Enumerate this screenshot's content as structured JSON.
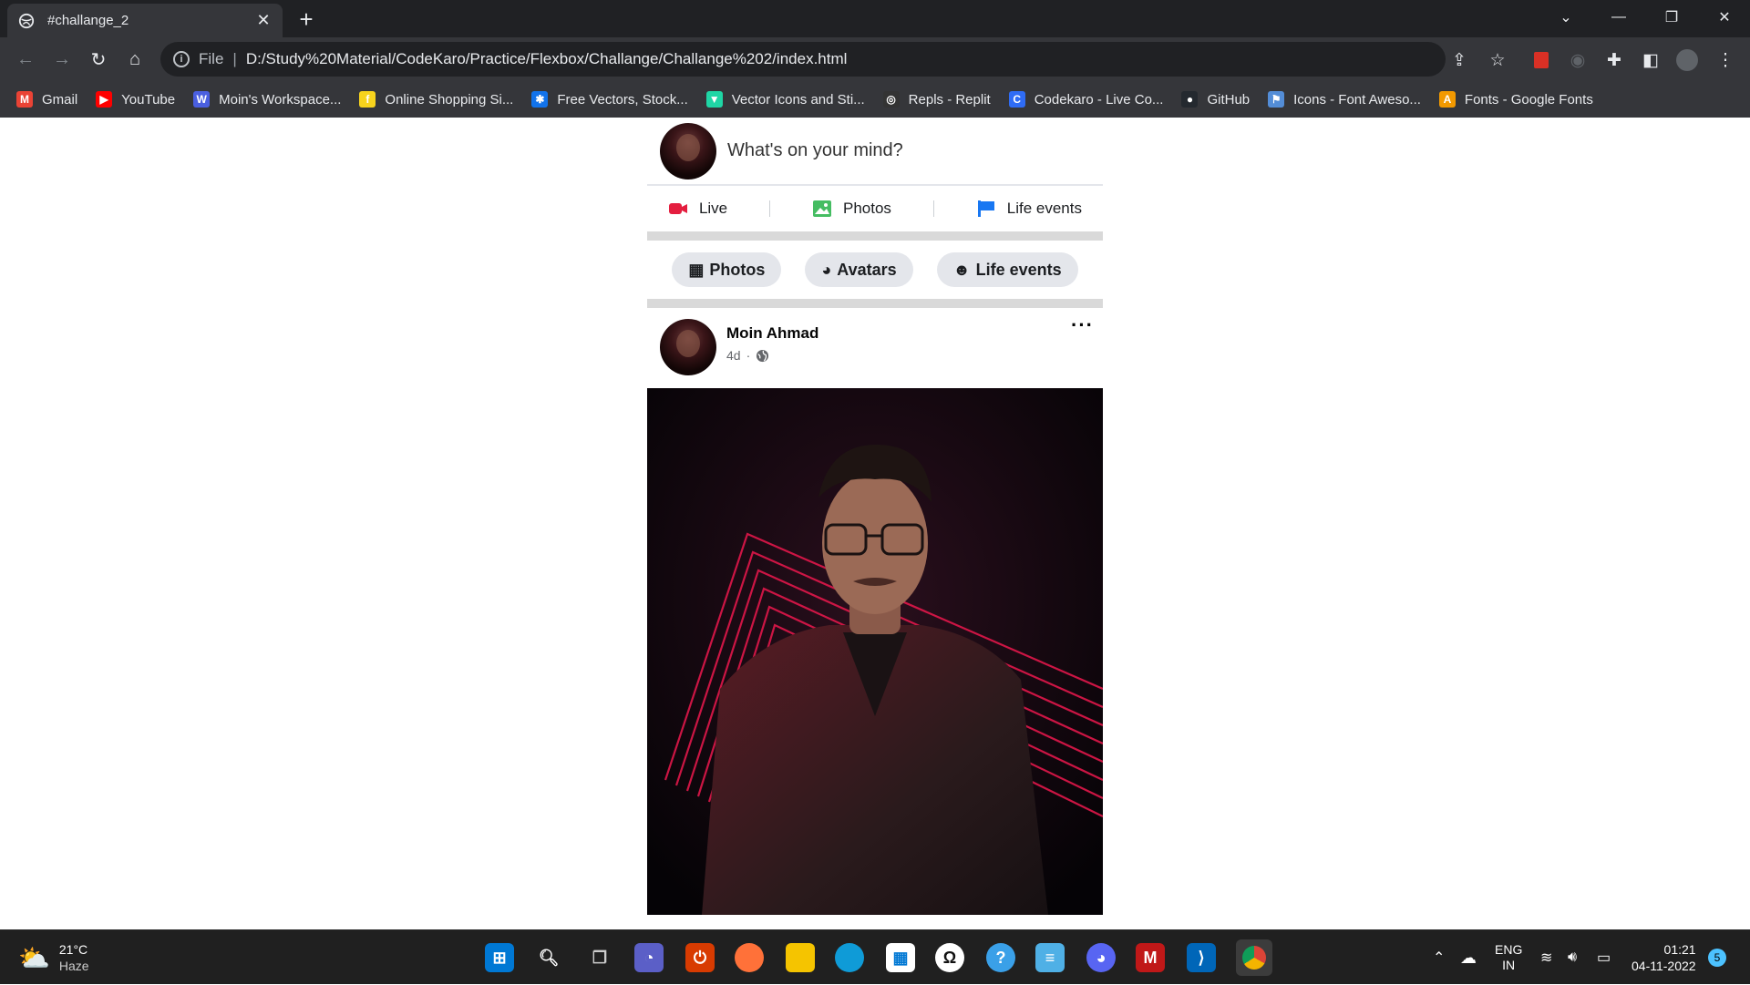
{
  "browser": {
    "tab_title": "#challange_2",
    "new_tab": "+",
    "address": {
      "scheme_label": "File",
      "separator": "|",
      "url": "D:/Study%20Material/CodeKaro/Practice/Flexbox/Challange/Challange%202/index.html"
    },
    "bookmarks": [
      {
        "label": "Gmail",
        "icon": "gmail-icon",
        "color": "#ea4335",
        "glyph": "M"
      },
      {
        "label": "YouTube",
        "icon": "youtube-icon",
        "color": "#ff0000",
        "glyph": "▶"
      },
      {
        "label": "Moin's Workspace...",
        "icon": "workspace-icon",
        "color": "#4a5fe0",
        "glyph": "W"
      },
      {
        "label": "Online Shopping Si...",
        "icon": "flipkart-icon",
        "color": "#f7d31d",
        "glyph": "f"
      },
      {
        "label": "Free Vectors, Stock...",
        "icon": "freepik-icon",
        "color": "#1273eb",
        "glyph": "✱"
      },
      {
        "label": "Vector Icons and Sti...",
        "icon": "flaticon-icon",
        "color": "#1fd6a5",
        "glyph": "▼"
      },
      {
        "label": "Repls - Replit",
        "icon": "replit-icon",
        "color": "#333333",
        "glyph": "◎"
      },
      {
        "label": "Codekaro - Live Co...",
        "icon": "codekaro-icon",
        "color": "#2f6cf5",
        "glyph": "C"
      },
      {
        "label": "GitHub",
        "icon": "github-icon",
        "color": "#24292f",
        "glyph": "●"
      },
      {
        "label": "Icons - Font Aweso...",
        "icon": "fontawesome-icon",
        "color": "#538dd7",
        "glyph": "⚑"
      },
      {
        "label": "Fonts - Google Fonts",
        "icon": "google-fonts-icon",
        "color": "#f29900",
        "glyph": "A"
      }
    ]
  },
  "composer": {
    "prompt": "What's on your mind?"
  },
  "actions_row1": [
    {
      "label": "Live",
      "icon": "live-video-icon",
      "color": "#e41e3f"
    },
    {
      "label": "Photos",
      "icon": "photos-icon",
      "color": "#45bd62"
    },
    {
      "label": "Life events",
      "icon": "flag-icon",
      "color": "#1877f2"
    }
  ],
  "actions_row2": [
    {
      "label": "Photos",
      "icon": "photo-stack-icon"
    },
    {
      "label": "Avatars",
      "icon": "avatar-icon"
    },
    {
      "label": "Life events",
      "icon": "smile-icon"
    }
  ],
  "post": {
    "author": "Moin Ahmad",
    "time": "4d",
    "dot": "·",
    "more": "···"
  },
  "taskbar": {
    "weather_temp": "21°C",
    "weather_desc": "Haze",
    "lang_top": "ENG",
    "lang_bottom": "IN",
    "time": "01:21",
    "date": "04-11-2022",
    "notification_count": "5"
  }
}
